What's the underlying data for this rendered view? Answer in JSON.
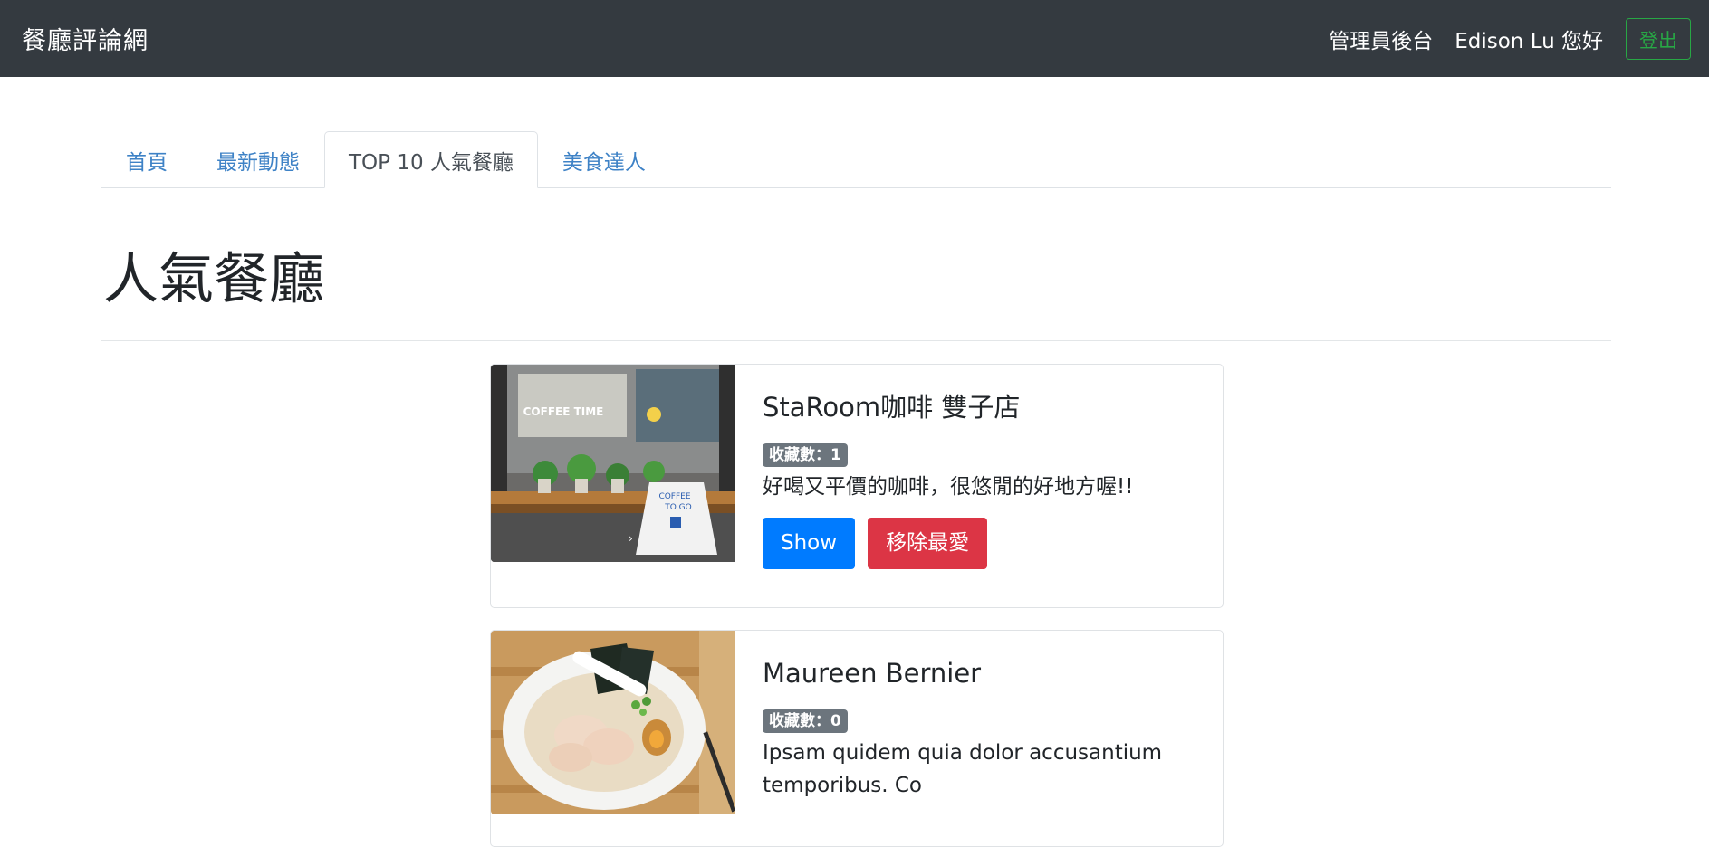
{
  "navbar": {
    "brand": "餐廳評論網",
    "admin_link": "管理員後台",
    "greeting": "Edison Lu 您好",
    "logout_label": "登出"
  },
  "tabs": [
    {
      "label": "首頁",
      "active": false
    },
    {
      "label": "最新動態",
      "active": false
    },
    {
      "label": "TOP 10 人氣餐廳",
      "active": true
    },
    {
      "label": "美食達人",
      "active": false
    }
  ],
  "page": {
    "title": "人氣餐廳"
  },
  "restaurants": [
    {
      "name": "StaRoom咖啡 雙子店",
      "favorites_label": "收藏數：1",
      "description": "好喝又平價的咖啡，很悠閒的好地方喔!!",
      "show_label": "Show",
      "remove_label": "移除最愛",
      "image_text_1": "COFFEE TIME",
      "image_text_2": "COFFEE",
      "image_text_3": "TO GO"
    },
    {
      "name": "Maureen Bernier",
      "favorites_label": "收藏數：0",
      "description": "Ipsam quidem quia dolor accusantium temporibus. Co"
    }
  ],
  "colors": {
    "navbar": "#343a40",
    "link": "#3e82c6",
    "primary": "#007bff",
    "danger": "#dc3545",
    "success": "#28a745",
    "badge": "#6c757d"
  }
}
